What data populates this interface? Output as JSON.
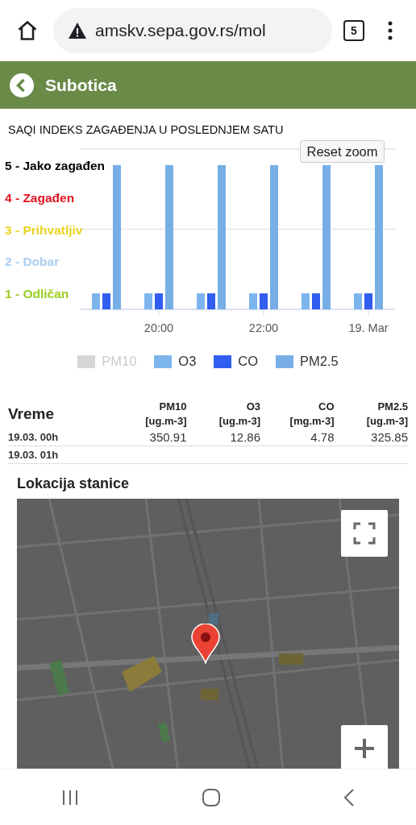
{
  "browser": {
    "url": "amskv.sepa.gov.rs/mol",
    "tab_count": "5"
  },
  "header": {
    "title": "Subotica"
  },
  "chart_section": {
    "title": "SAQI INDEKS ZAGAĐENJA U POSLEDNJEM SATU",
    "reset_button": "Reset zoom",
    "chart_data": {
      "type": "bar",
      "ylim": [
        0.5,
        5.5
      ],
      "yticks": [
        {
          "value": 5,
          "label": "5 - Jako zagađen"
        },
        {
          "value": 4,
          "label": "4 - Zagađen"
        },
        {
          "value": 3,
          "label": "3 - Prihvatljiv"
        },
        {
          "value": 2,
          "label": "2 - Dobar"
        },
        {
          "value": 1,
          "label": "1 - Odličan"
        }
      ],
      "categories": [
        null,
        "20:00",
        null,
        "22:00",
        null,
        "19. Mar"
      ],
      "series": [
        {
          "name": "PM10",
          "color": "#cccccc",
          "values": [
            null,
            null,
            null,
            null,
            null,
            null
          ]
        },
        {
          "name": "O3",
          "color": "#7cb5ec",
          "values": [
            1,
            1,
            1,
            1,
            1,
            1
          ]
        },
        {
          "name": "CO",
          "color": "#2f5ef0",
          "values": [
            1,
            1,
            1,
            1,
            1,
            1
          ]
        },
        {
          "name": "PM2.5",
          "color": "#78aee6",
          "values": [
            5,
            5,
            5,
            5,
            5,
            5
          ]
        }
      ]
    },
    "level_labels": [
      {
        "color": "#000000"
      },
      {
        "color": "#e0141e"
      },
      {
        "color": "#e8d21f"
      },
      {
        "color": "#a8cdf0"
      },
      {
        "color": "#9acd1e"
      }
    ],
    "legend_items": [
      {
        "selected": false
      },
      {
        "selected": true
      },
      {
        "selected": true
      },
      {
        "selected": true
      }
    ]
  },
  "table": {
    "columns": [
      {
        "name": "Vreme"
      },
      {
        "name": "PM10",
        "unit": "[ug.m-3]"
      },
      {
        "name": "O3",
        "unit": "[ug.m-3]"
      },
      {
        "name": "CO",
        "unit": "[mg.m-3]"
      },
      {
        "name": "PM2.5",
        "unit": "[ug.m-3]"
      }
    ],
    "rows": [
      {
        "cells": [
          "19.03. 00h",
          "350.91",
          "12.86",
          "4.78",
          "325.85"
        ]
      },
      {
        "cells": [
          "19.03. 01h"
        ]
      }
    ]
  },
  "map": {
    "title": "Lokacija stanice",
    "kind": "picture"
  }
}
